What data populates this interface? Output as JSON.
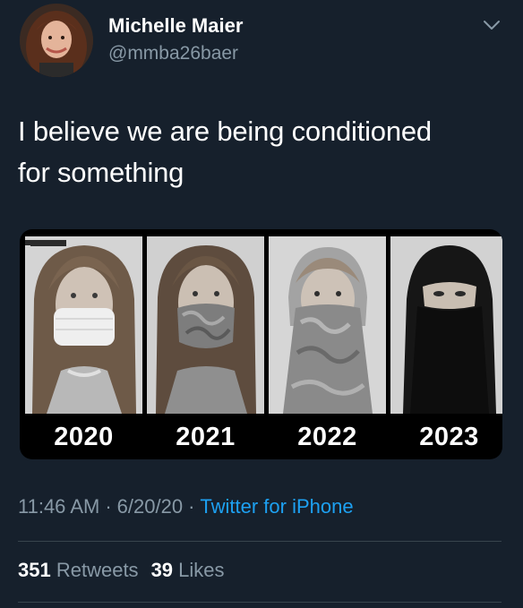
{
  "tweet": {
    "author": {
      "display_name": "Michelle Maier",
      "handle": "@mmba26baer"
    },
    "text_line1": "I believe we are being conditioned",
    "text_line2": "for something",
    "media": {
      "panels": [
        {
          "year": "2020"
        },
        {
          "year": "2021"
        },
        {
          "year": "2022"
        },
        {
          "year": "2023"
        }
      ]
    },
    "meta": {
      "time": "11:46 AM",
      "separator": "·",
      "date": "6/20/20",
      "client": "Twitter for iPhone"
    },
    "stats": {
      "retweets_count": "351",
      "retweets_label": "Retweets",
      "likes_count": "39",
      "likes_label": "Likes"
    }
  },
  "colors": {
    "background": "#16202c",
    "secondary_text": "#8899a6",
    "link": "#1da1f2",
    "divider": "#38444d"
  },
  "icons": {
    "menu": "chevron-down-icon"
  }
}
